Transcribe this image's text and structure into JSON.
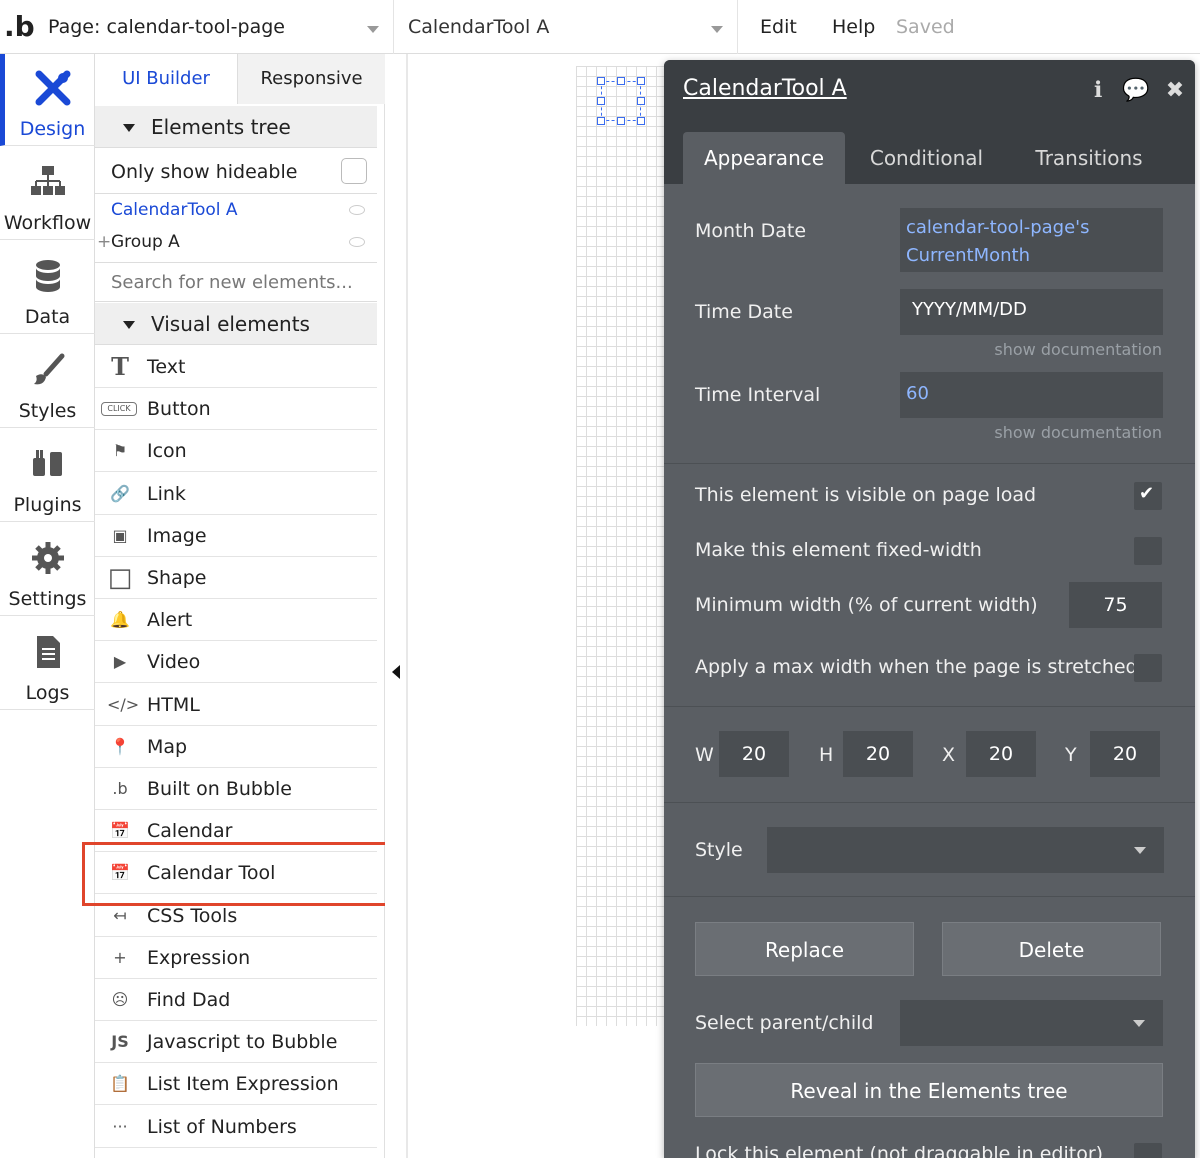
{
  "topbar": {
    "logo": ".b",
    "page_select": "Page: calendar-tool-page",
    "element_select": "CalendarTool A",
    "menu_edit": "Edit",
    "menu_help": "Help",
    "status": "Saved"
  },
  "leftnav": {
    "items": [
      {
        "label": "Design",
        "icon": "design-icon"
      },
      {
        "label": "Workflow",
        "icon": "workflow-icon"
      },
      {
        "label": "Data",
        "icon": "database-icon"
      },
      {
        "label": "Styles",
        "icon": "brush-icon"
      },
      {
        "label": "Plugins",
        "icon": "plug-icon"
      },
      {
        "label": "Settings",
        "icon": "gear-icon"
      },
      {
        "label": "Logs",
        "icon": "document-icon"
      }
    ]
  },
  "panel": {
    "tab_ui": "UI Builder",
    "tab_responsive": "Responsive",
    "elements_tree": "Elements tree",
    "only_hideable": "Only show hideable",
    "tree": [
      "CalendarTool A",
      "Group A"
    ],
    "search_placeholder": "Search for new elements...",
    "visual_elements": "Visual elements",
    "elements": [
      {
        "label": "Text",
        "icon": "T"
      },
      {
        "label": "Button",
        "icon": "CLICK"
      },
      {
        "label": "Icon",
        "icon": "⚑"
      },
      {
        "label": "Link",
        "icon": "🔗"
      },
      {
        "label": "Image",
        "icon": "▣"
      },
      {
        "label": "Shape",
        "icon": "□"
      },
      {
        "label": "Alert",
        "icon": "🔔"
      },
      {
        "label": "Video",
        "icon": "▶"
      },
      {
        "label": "HTML",
        "icon": "</>"
      },
      {
        "label": "Map",
        "icon": "📍"
      },
      {
        "label": "Built on Bubble",
        "icon": ".b"
      },
      {
        "label": "Calendar",
        "icon": "📅"
      },
      {
        "label": "Calendar Tool",
        "icon": "📅"
      },
      {
        "label": "CSS Tools",
        "icon": "↤"
      },
      {
        "label": "Expression",
        "icon": "+"
      },
      {
        "label": "Find Dad",
        "icon": "☹"
      },
      {
        "label": "Javascript to Bubble",
        "icon": "JS"
      },
      {
        "label": "List Item Expression",
        "icon": "📋"
      },
      {
        "label": "List of Numbers",
        "icon": "···"
      }
    ]
  },
  "editor": {
    "title": "CalendarTool A",
    "tabs": [
      "Appearance",
      "Conditional",
      "Transitions"
    ],
    "month_date_label": "Month Date",
    "month_date_value": "calendar-tool-page's CurrentMonth",
    "time_date_label": "Time Date",
    "time_date_value": "YYYY/MM/DD",
    "show_doc": "show documentation",
    "time_interval_label": "Time Interval",
    "time_interval_value": "60",
    "visible_on_load": "This element is visible on page load",
    "fixed_width": "Make this element fixed-width",
    "min_width": "Minimum width (% of current width)",
    "min_width_value": "75",
    "max_width": "Apply a max width when the page is stretched",
    "w_label": "W",
    "w_value": "20",
    "h_label": "H",
    "h_value": "20",
    "x_label": "X",
    "x_value": "20",
    "y_label": "Y",
    "y_value": "20",
    "style_label": "Style",
    "replace": "Replace",
    "delete": "Delete",
    "select_parent": "Select parent/child",
    "reveal": "Reveal in the Elements tree",
    "lock": "Lock this element (not draggable in editor)"
  }
}
